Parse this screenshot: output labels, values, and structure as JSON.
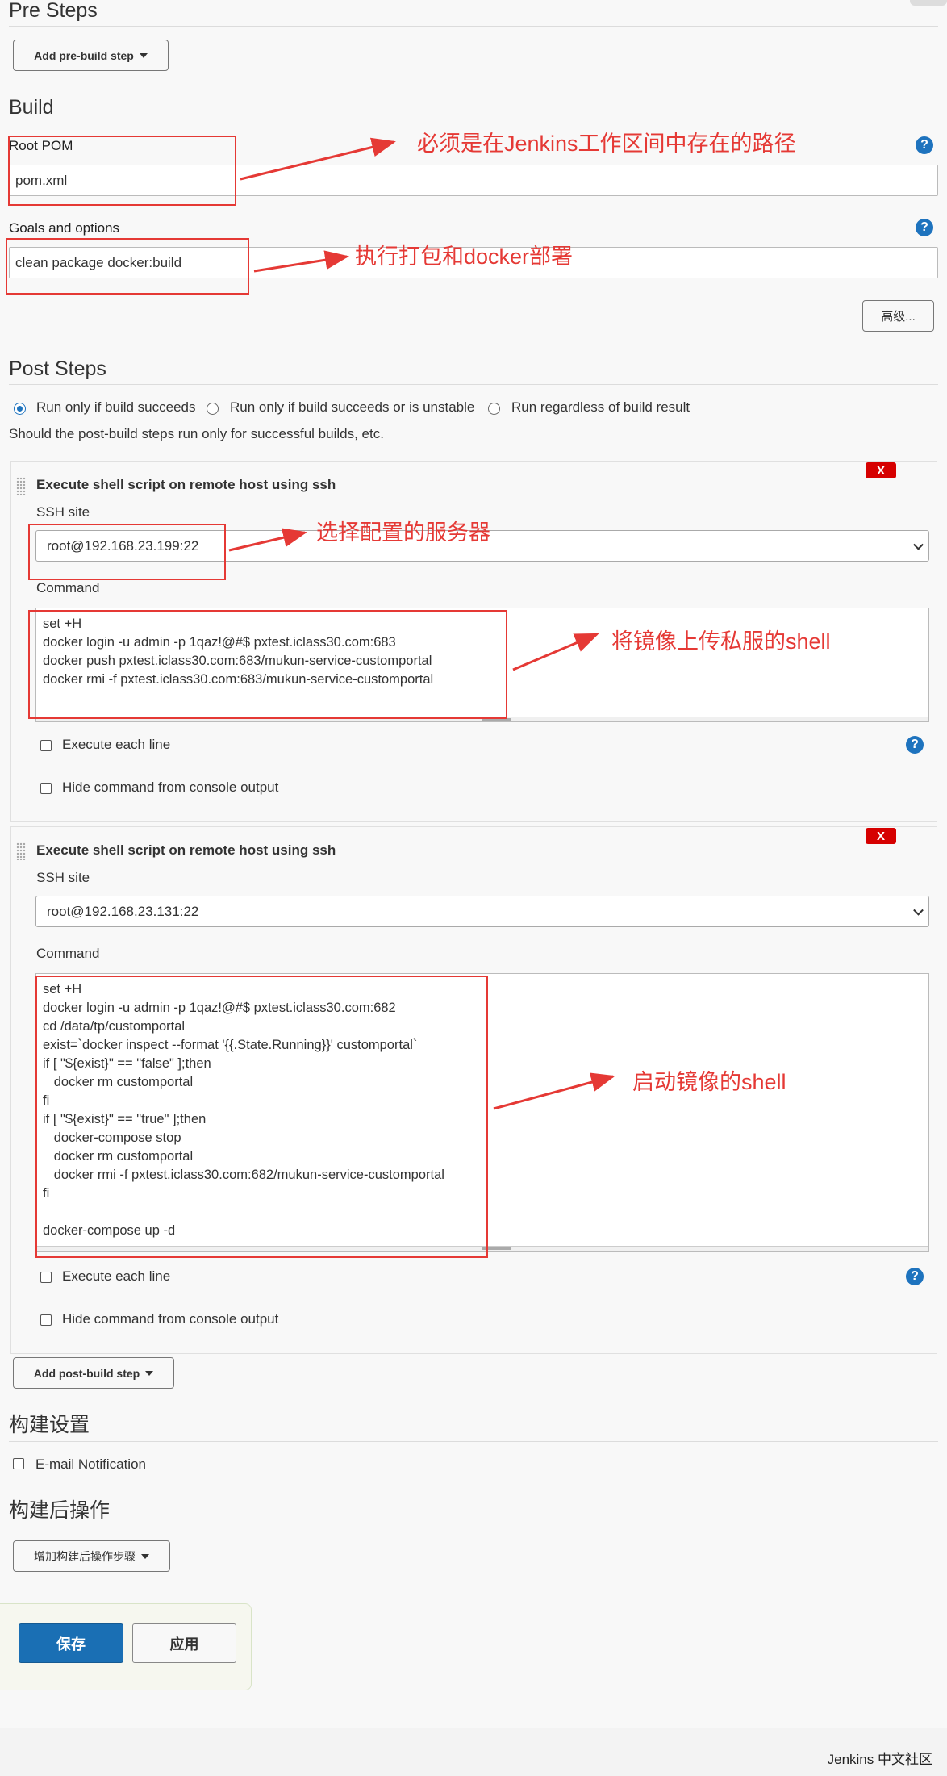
{
  "pre_steps": {
    "title": "Pre Steps",
    "add_button": "Add pre-build step"
  },
  "build": {
    "title": "Build",
    "root_pom_label": "Root POM",
    "root_pom_value": "pom.xml",
    "goals_label": "Goals and options",
    "goals_value": "clean package docker:build",
    "advanced_button": "高级...",
    "help_icon": "?"
  },
  "post_steps": {
    "title": "Post Steps",
    "radio_options": [
      "Run only if build succeeds",
      "Run only if build succeeds or is unstable",
      "Run regardless of build result"
    ],
    "selected_option": "Run only if build succeeds",
    "description": "Should the post-build steps run only for successful builds, etc."
  },
  "ssh_steps": [
    {
      "title": "Execute shell script on remote host using ssh",
      "ssh_site_label": "SSH site",
      "ssh_site_value": "root@192.168.23.199:22",
      "command_label": "Command",
      "command": "set +H\ndocker login -u admin -p 1qaz!@#$ pxtest.iclass30.com:683\ndocker push pxtest.iclass30.com:683/mukun-service-customportal\ndocker rmi -f pxtest.iclass30.com:683/mukun-service-customportal",
      "execute_each_line": "Execute each line",
      "hide_command": "Hide command from console output",
      "delete_label": "X"
    },
    {
      "title": "Execute shell script on remote host using ssh",
      "ssh_site_label": "SSH site",
      "ssh_site_value": "root@192.168.23.131:22",
      "command_label": "Command",
      "command": "set +H\ndocker login -u admin -p 1qaz!@#$ pxtest.iclass30.com:682\ncd /data/tp/customportal\nexist=`docker inspect --format '{{.State.Running}}' customportal`\nif [ \"${exist}\" == \"false\" ];then\n   docker rm customportal\nfi\nif [ \"${exist}\" == \"true\" ];then\n   docker-compose stop\n   docker rm customportal\n   docker rmi -f pxtest.iclass30.com:682/mukun-service-customportal\nfi\n\ndocker-compose up -d",
      "execute_each_line": "Execute each line",
      "hide_command": "Hide command from console output",
      "delete_label": "X"
    }
  ],
  "add_post_build_step": "Add post-build step",
  "build_settings": {
    "title": "构建设置",
    "email_notification": "E-mail Notification"
  },
  "post_build_actions": {
    "title": "构建后操作",
    "add_button": "增加构建后操作步骤"
  },
  "footer_buttons": {
    "save": "保存",
    "apply": "应用"
  },
  "footer": {
    "brand": "Jenkins 中文社区"
  },
  "annotations": {
    "root_pom_note": "必须是在Jenkins工作区间中存在的路径",
    "goals_note": "执行打包和docker部署",
    "ssh_site_note": "选择配置的服务器",
    "command1_note": "将镜像上传私服的shell",
    "command2_note": "启动镜像的shell"
  },
  "colors": {
    "annotation_red": "#e53935",
    "primary_blue": "#1e73be",
    "delete_red": "#d60000"
  }
}
